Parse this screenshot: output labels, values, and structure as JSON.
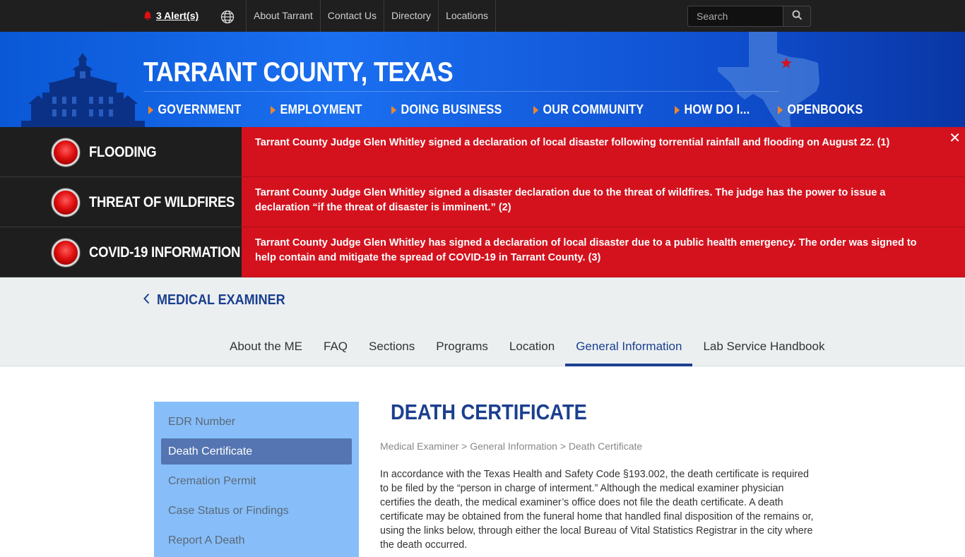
{
  "topbar": {
    "alerts_label": "3 Alert(s)",
    "nav": [
      "About Tarrant",
      "Contact Us",
      "Directory",
      "Locations"
    ],
    "search_placeholder": "Search"
  },
  "header": {
    "title": "TARRANT COUNTY, TEXAS",
    "nav": [
      "GOVERNMENT",
      "EMPLOYMENT",
      "DOING BUSINESS",
      "OUR COMMUNITY",
      "HOW DO I...",
      "OPENBOOKS"
    ],
    "accent_color": "#f0852a",
    "blue": "#1a6ff0"
  },
  "alerts": [
    {
      "label": "FLOODING",
      "message": "Tarrant County Judge Glen Whitley signed a declaration of local disaster following torrential rainfall and flooding on August 22. (1)"
    },
    {
      "label": "THREAT OF WILDFIRES",
      "message": "Tarrant County Judge Glen Whitley signed a disaster declaration due to the threat of wildfires. The judge has the power to issue a declaration “if the threat of disaster is imminent.” (2)"
    },
    {
      "label": "COVID-19 INFORMATION",
      "message": "Tarrant County Judge Glen Whitley has signed a declaration of local disaster due to a public health emergency. The order was signed to help contain and mitigate the spread of COVID-19 in Tarrant County. (3)"
    }
  ],
  "alert_color": "#d4121e",
  "department": {
    "name": "MEDICAL EXAMINER",
    "tabs": [
      "About the ME",
      "FAQ",
      "Sections",
      "Programs",
      "Location",
      "General Information",
      "Lab Service Handbook"
    ],
    "active_tab": "General Information"
  },
  "sidebar": {
    "items": [
      "EDR Number",
      "Death Certificate",
      "Cremation Permit",
      "Case Status or Findings",
      "Report A Death"
    ],
    "active": "Death Certificate"
  },
  "main": {
    "heading": "DEATH CERTIFICATE",
    "breadcrumb": "Medical Examiner > General Information > Death Certificate",
    "body": "In accordance with the Texas Health and Safety Code §193.002, the death certificate is required to be filed by the “person in charge of interment.”  Although the medical examiner physician certifies the death, the medical examiner’s office does not file the death certificate.  A death certificate may be obtained from the funeral home that handled final disposition of the remains or, using the links below, through either the local Bureau of Vital Statistics Registrar in the city where the death occurred."
  }
}
